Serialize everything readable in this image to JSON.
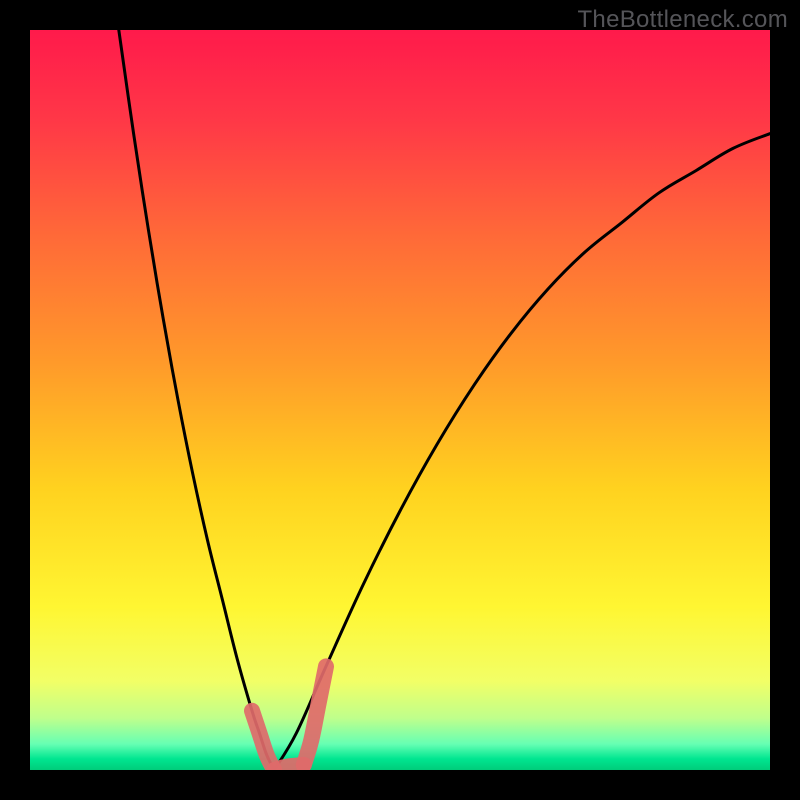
{
  "watermark": "TheBottleneck.com",
  "chart_data": {
    "type": "line",
    "title": "",
    "xlabel": "",
    "ylabel": "",
    "xlim": [
      0,
      100
    ],
    "ylim": [
      0,
      100
    ],
    "x_min_point": 33,
    "series": [
      {
        "name": "curve-left",
        "x": [
          12,
          14,
          16,
          18,
          20,
          22,
          24,
          26,
          28,
          30,
          31,
          32,
          33
        ],
        "y": [
          100,
          86,
          73,
          61,
          50,
          40,
          31,
          23,
          15,
          8,
          5,
          2,
          0
        ]
      },
      {
        "name": "curve-right",
        "x": [
          33,
          36,
          40,
          45,
          50,
          55,
          60,
          65,
          70,
          75,
          80,
          85,
          90,
          95,
          100
        ],
        "y": [
          0,
          5,
          14,
          25,
          35,
          44,
          52,
          59,
          65,
          70,
          74,
          78,
          81,
          84,
          86
        ]
      }
    ],
    "highlight_segments": [
      {
        "name": "left-highlight",
        "color": "#e06a6a",
        "x": [
          30,
          31,
          32,
          33
        ],
        "y": [
          8,
          5,
          2,
          0
        ]
      },
      {
        "name": "bottom-highlight",
        "color": "#e06a6a",
        "x": [
          33,
          34,
          35,
          36,
          37
        ],
        "y": [
          0,
          0.3,
          0.5,
          0.6,
          0.7
        ]
      },
      {
        "name": "right-highlight",
        "color": "#e06a6a",
        "x": [
          37,
          38,
          39,
          40
        ],
        "y": [
          0.7,
          4,
          9,
          14
        ]
      }
    ],
    "background_gradient": {
      "type": "vertical",
      "stops": [
        {
          "offset": 0.0,
          "color": "#ff1a4b"
        },
        {
          "offset": 0.12,
          "color": "#ff3747"
        },
        {
          "offset": 0.28,
          "color": "#ff6a38"
        },
        {
          "offset": 0.45,
          "color": "#ff9a2a"
        },
        {
          "offset": 0.62,
          "color": "#ffd21f"
        },
        {
          "offset": 0.78,
          "color": "#fff632"
        },
        {
          "offset": 0.88,
          "color": "#f2ff66"
        },
        {
          "offset": 0.93,
          "color": "#bfff8c"
        },
        {
          "offset": 0.965,
          "color": "#66ffb3"
        },
        {
          "offset": 0.985,
          "color": "#00e690"
        },
        {
          "offset": 1.0,
          "color": "#00cc7a"
        }
      ]
    }
  }
}
